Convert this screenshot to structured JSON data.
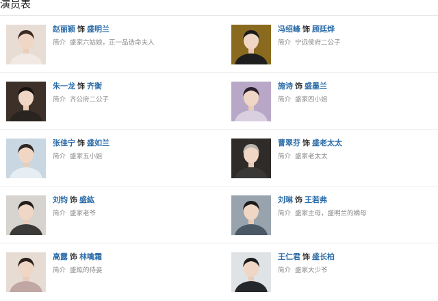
{
  "header": {
    "title": "演员表"
  },
  "cast": [
    {
      "left": {
        "actor": "赵丽颖",
        "as": "饰",
        "role": "盛明兰",
        "label": "简介",
        "desc": "盛家六姑娘，正一品诰命夫人",
        "photo_bg": "#e8ddd5",
        "hair": "#3a2a22",
        "cloth": "#f2e9e4"
      },
      "right": {
        "actor": "冯绍峰",
        "as": "饰",
        "role": "顾廷烨",
        "label": "简介",
        "desc": "宁远侯府二公子",
        "photo_bg": "#8a6a1e",
        "hair": "#1b1b1b",
        "cloth": "#1e1e1e"
      }
    },
    {
      "left": {
        "actor": "朱一龙",
        "as": "饰",
        "role": "齐衡",
        "label": "简介",
        "desc": "齐公府二公子",
        "photo_bg": "#3d3028",
        "hair": "#161210",
        "cloth": "#2a2420"
      },
      "right": {
        "actor": "施诗",
        "as": "饰",
        "role": "盛墨兰",
        "label": "简介",
        "desc": "盛家四小姐",
        "photo_bg": "#b9a7c8",
        "hair": "#2a1f2b",
        "cloth": "#d8cfe0"
      }
    },
    {
      "left": {
        "actor": "张佳宁",
        "as": "饰",
        "role": "盛如兰",
        "label": "简介",
        "desc": "盛家五小姐",
        "photo_bg": "#c9d7e2",
        "hair": "#2f2623",
        "cloth": "#e7eef3"
      },
      "right": {
        "actor": "曹翠芬",
        "as": "饰",
        "role": "盛老太太",
        "label": "简介",
        "desc": "盛家老太太",
        "photo_bg": "#2e2b28",
        "hair": "#b9b4ae",
        "cloth": "#3a3836"
      }
    },
    {
      "left": {
        "actor": "刘钧",
        "as": "饰",
        "role": "盛紘",
        "label": "简介",
        "desc": "盛家老爷",
        "photo_bg": "#d7d3cf",
        "hair": "#221c18",
        "cloth": "#3b3a39"
      },
      "right": {
        "actor": "刘琳",
        "as": "饰",
        "role": "王若弗",
        "label": "简介",
        "desc": "盛家主母，盛明兰的嫡母",
        "photo_bg": "#98a3ad",
        "hair": "#1d1a1a",
        "cloth": "#4a5866"
      }
    },
    {
      "left": {
        "actor": "高露",
        "as": "饰",
        "role": "林噙霜",
        "label": "简介",
        "desc": "盛紘的侍妾",
        "photo_bg": "#e6dcd4",
        "hair": "#2c211c",
        "cloth": "#c0a7a3"
      },
      "right": {
        "actor": "王仁君",
        "as": "饰",
        "role": "盛长柏",
        "label": "简介",
        "desc": "盛家大少爷",
        "photo_bg": "#dfe3e6",
        "hair": "#1b1b1b",
        "cloth": "#25272b"
      }
    }
  ]
}
